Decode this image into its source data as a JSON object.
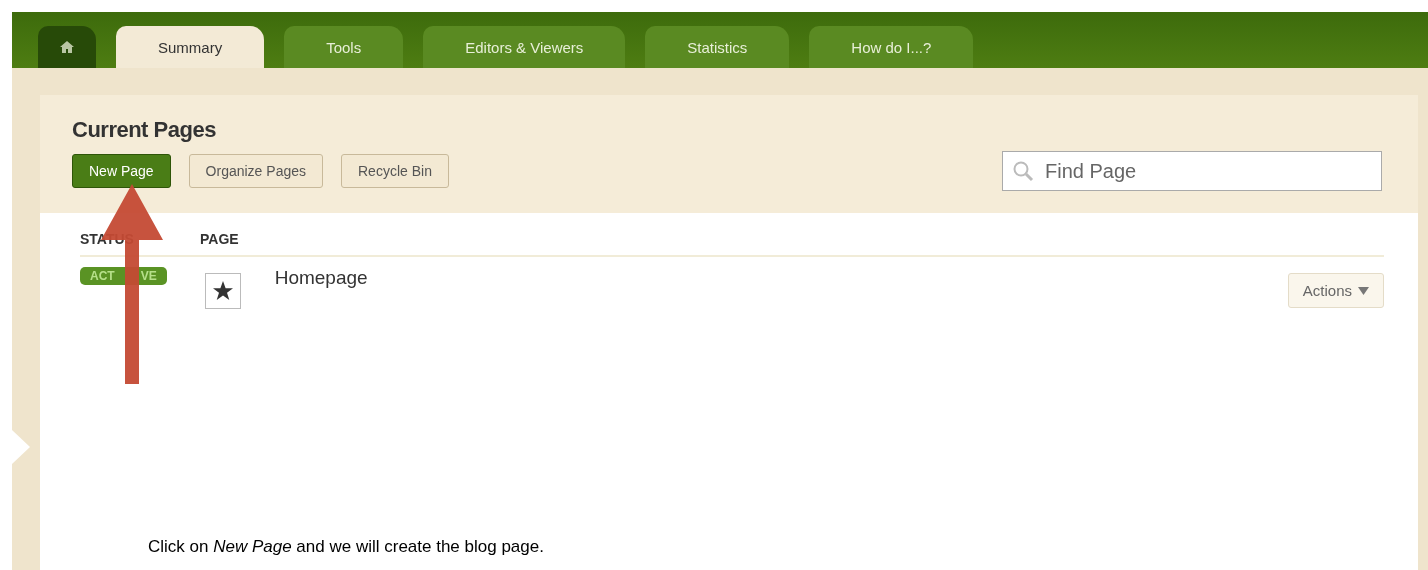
{
  "tabs": [
    {
      "kind": "home",
      "selected": false
    },
    {
      "kind": "text",
      "label": "Summary",
      "selected": true
    },
    {
      "kind": "text",
      "label": "Tools",
      "selected": false
    },
    {
      "kind": "text",
      "label": "Editors & Viewers",
      "selected": false
    },
    {
      "kind": "text",
      "label": "Statistics",
      "selected": false
    },
    {
      "kind": "text",
      "label": "How do I...?",
      "selected": false
    }
  ],
  "heading": "Current Pages",
  "buttons": [
    {
      "label": "New Page",
      "primary": true
    },
    {
      "label": "Organize Pages",
      "primary": false
    },
    {
      "label": "Recycle Bin",
      "primary": false
    }
  ],
  "search": {
    "placeholder": "Find Page"
  },
  "table": {
    "columns": [
      "STATUS",
      "PAGE"
    ],
    "rows": [
      {
        "status": [
          "ACT",
          "VE"
        ],
        "page": "Homepage",
        "starred": true,
        "action": "Actions"
      }
    ]
  },
  "caption": "Click on *New Page*  and we will create the blog page."
}
